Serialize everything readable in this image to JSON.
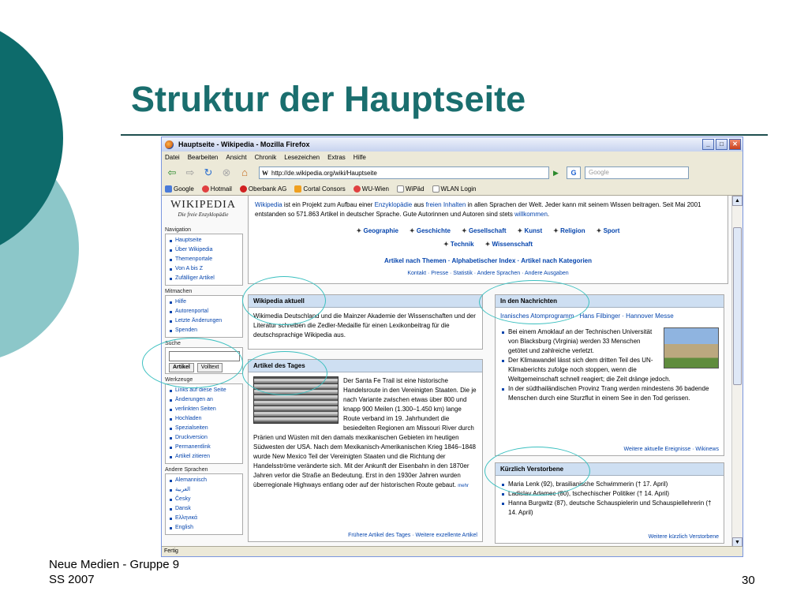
{
  "slide": {
    "title": "Struktur der Hauptseite",
    "footer_line1": "Neue Medien - Gruppe 9",
    "footer_line2": "SS 2007",
    "page_number": "30",
    "accent_color": "#1a6e6e"
  },
  "browser": {
    "window_title": "Hauptseite - Wikipedia - Mozilla Firefox",
    "menu": [
      "Datei",
      "Bearbeiten",
      "Ansicht",
      "Chronik",
      "Lesezeichen",
      "Extras",
      "Hilfe"
    ],
    "url": "http://de.wikipedia.org/wiki/Hauptseite",
    "search_placeholder": "Google",
    "bookmarks": [
      "Google",
      "Hotmail",
      "Oberbank AG",
      "Cortal Consors",
      "WU-Wien",
      "WiPäd",
      "WLAN Login"
    ],
    "status": "Fertig"
  },
  "wiki": {
    "logo_title": "WIKIPEDIA",
    "logo_subtitle": "Die freie Enzyklopädie",
    "nav_heading": "Navigation",
    "nav": [
      "Hauptseite",
      "Über Wikipedia",
      "Themenportale",
      "Von A bis Z",
      "Zufälliger Artikel"
    ],
    "mit_heading": "Mitmachen",
    "mitmachen": [
      "Hilfe",
      "Autorenportal",
      "Letzte Änderungen",
      "Spenden"
    ],
    "search_heading": "Suche",
    "search_btn1": "Artikel",
    "search_btn2": "Volltext",
    "tools_heading": "Werkzeuge",
    "tools": [
      "Links auf diese Seite",
      "Änderungen an",
      "verlinkten Seiten",
      "Hochladen",
      "Spezialseiten",
      "Druckversion",
      "Permanentlink",
      "Artikel zitieren"
    ],
    "lang_heading": "Andere Sprachen",
    "langs": [
      "Alemannisch",
      "العربية",
      "Česky",
      "Dansk",
      "Ελληνικά",
      "English"
    ],
    "intro_1": "Wikipedia",
    "intro_2": " ist ein Projekt zum Aufbau einer ",
    "intro_3": "Enzyklopädie",
    "intro_4": " aus ",
    "intro_5": "freien Inhalten",
    "intro_6": " in allen Sprachen der Welt. Jeder kann mit seinem Wissen beitragen. Seit Mai 2001 entstanden so 571.863 Artikel in deutscher Sprache. Gute Autorinnen und Autoren sind stets ",
    "intro_7": "willkommen",
    "intro_8": ".",
    "portals_row1": [
      "Geographie",
      "Geschichte",
      "Gesellschaft",
      "Kunst",
      "Religion",
      "Sport"
    ],
    "portals_row2": [
      "Technik",
      "Wissenschaft"
    ],
    "index_line": "Artikel nach Themen · Alphabetischer Index · Artikel nach Kategorien",
    "minor_line": "Kontakt · Presse · Statistik · Andere Sprachen · Andere Ausgaben",
    "aktuell_h": "Wikipedia aktuell",
    "aktuell_b": "Wikimedia Deutschland und die Mainzer Akademie der Wissenschaften und der Literatur schreiben die Zedler-Medaille für einen Lexikonbeitrag für die deutschsprachige Wikipedia aus.",
    "tages_h": "Artikel des Tages",
    "tages_b": "Der Santa Fe Trail ist eine historische Handelsroute in den Vereinigten Staaten. Die je nach Variante zwischen etwas über 800 und knapp 900 Meilen (1.300–1.450 km) lange Route verband im 19. Jahrhundert die besiedelten Regionen am Missouri River durch Prärien und Wüsten mit den damals mexikanischen Gebieten im heutigen Südwesten der USA. Nach dem Mexikanisch-Amerikanischen Krieg 1846–1848 wurde New Mexico Teil der Vereinigten Staaten und die Richtung der Handelsströme veränderte sich. Mit der Ankunft der Eisenbahn in den 1870er Jahren verlor die Straße an Bedeutung. Erst in den 1930er Jahren wurden überregionale Highways entlang oder auf der historischen Route gebaut.",
    "tages_mehr": "mehr",
    "tages_foot": "Frühere Artikel des Tages · Weitere exzellente Artikel",
    "news_h": "In den Nachrichten",
    "news_links": "Iranisches Atomprogramm · Hans Filbinger · Hannover Messe",
    "news_items": [
      "Bei einem Amoklauf an der Technischen Universität von Blacksburg (Virginia) werden 33 Menschen getötet und zahlreiche verletzt.",
      "Der Klimawandel lässt sich dem dritten Teil des UN-Klimaberichts zufolge noch stoppen, wenn die Weltgemeinschaft schnell reagiert; die Zeit dränge jedoch.",
      "In der südthailändischen Provinz Trang werden mindestens 36 badende Menschen durch eine Sturzflut in einem See in den Tod gerissen."
    ],
    "news_foot": "Weitere aktuelle Ereignisse · Wikinews",
    "dead_h": "Kürzlich Verstorbene",
    "dead_items": [
      "Maria Lenk (92), brasilianische Schwimmerin († 17. April)",
      "Ladislav Adamec (80), tschechischer Politiker († 14. April)",
      "Hanna Burgwitz (87), deutsche Schauspielerin und Schauspiellehrerin († 14. April)"
    ],
    "dead_foot": "Weitere kürzlich Verstorbene"
  }
}
